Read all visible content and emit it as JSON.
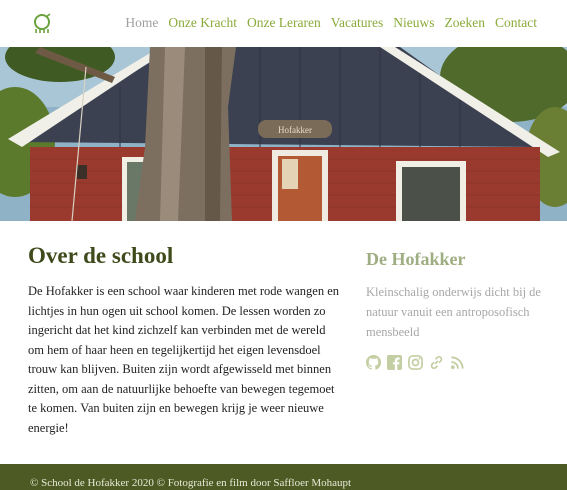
{
  "nav": {
    "items": [
      {
        "label": "Home"
      },
      {
        "label": "Onze Kracht"
      },
      {
        "label": "Onze Leraren"
      },
      {
        "label": "Vacatures"
      },
      {
        "label": "Nieuws"
      },
      {
        "label": "Zoeken"
      },
      {
        "label": "Contact"
      }
    ]
  },
  "main": {
    "title": "Over de school",
    "body": "De Hofakker is een school waar kinderen met rode wangen en lichtjes in hun ogen uit school komen. De lessen worden zo ingericht dat het kind zichzelf kan verbinden met de wereld om hem of haar heen en tegelijkertijd het eigen levensdoel trouw kan blijven. Buiten zijn wordt afgewisseld met binnen zitten, om aan de natuurlijke behoefte van bewegen tegemoet te komen. Van buiten zijn en bewegen krijg je weer nieuwe energie!"
  },
  "sidebar": {
    "title": "De Hofakker",
    "tagline": "Kleinschalig onderwijs dicht bij de natuur vanuit een antroposofisch mensbeeld",
    "social_icons": [
      "github-icon",
      "facebook-icon",
      "instagram-icon",
      "link-icon",
      "rss-icon"
    ]
  },
  "hero": {
    "sign_text": "Hofakker"
  },
  "footer": {
    "text": "© School de Hofakker 2020 © Fotografie en film door Saffloer Mohaupt"
  },
  "colors": {
    "accent": "#8aab3a",
    "title": "#3e4a1c",
    "sidebar_title": "#9fae82",
    "footer_bg": "#4e5a24"
  }
}
